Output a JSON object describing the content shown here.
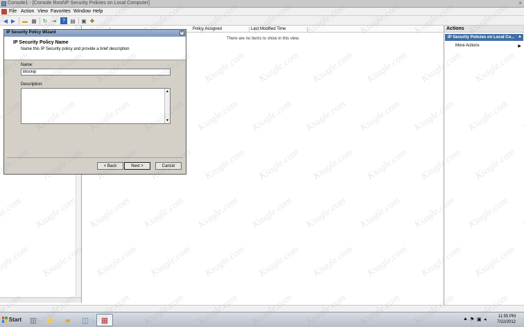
{
  "window": {
    "title": "Console1 - [Console Root\\IP Security Policies on Local Computer]",
    "close_glyph": "×"
  },
  "menu": {
    "items": [
      "File",
      "Action",
      "View",
      "Favorites",
      "Window",
      "Help"
    ]
  },
  "toolbar": {
    "icons": [
      "back-arrow-icon",
      "forward-arrow-icon",
      "folder-icon",
      "console-tree-icon",
      "refresh-icon",
      "export-icon",
      "help-icon",
      "properties-icon",
      "add-icon",
      "assign-icon"
    ]
  },
  "list": {
    "columns": [
      "Policy Assigned",
      "Last Modified Time"
    ],
    "empty_message": "There are no items to show in this view."
  },
  "actions": {
    "title": "Actions",
    "section_title": "IP Security Policies on Local Co...",
    "items": [
      {
        "label": "More Actions",
        "arrow": "▶"
      }
    ]
  },
  "dialog": {
    "title": "IP Security Policy Wizard",
    "heading": "IP Security Policy Name",
    "subheading": "Name this IP Security policy and provide a brief description",
    "name_label": "Name:",
    "name_value": "Blockip",
    "description_label": "Description:",
    "description_value": "",
    "buttons": {
      "back": "< Back",
      "next": "Next >",
      "cancel": "Cancel"
    }
  },
  "taskbar": {
    "start_label": "Start",
    "clock_time": "11:55 PM",
    "clock_date": "7/22/2012"
  },
  "watermark": "Ksugle.com"
}
